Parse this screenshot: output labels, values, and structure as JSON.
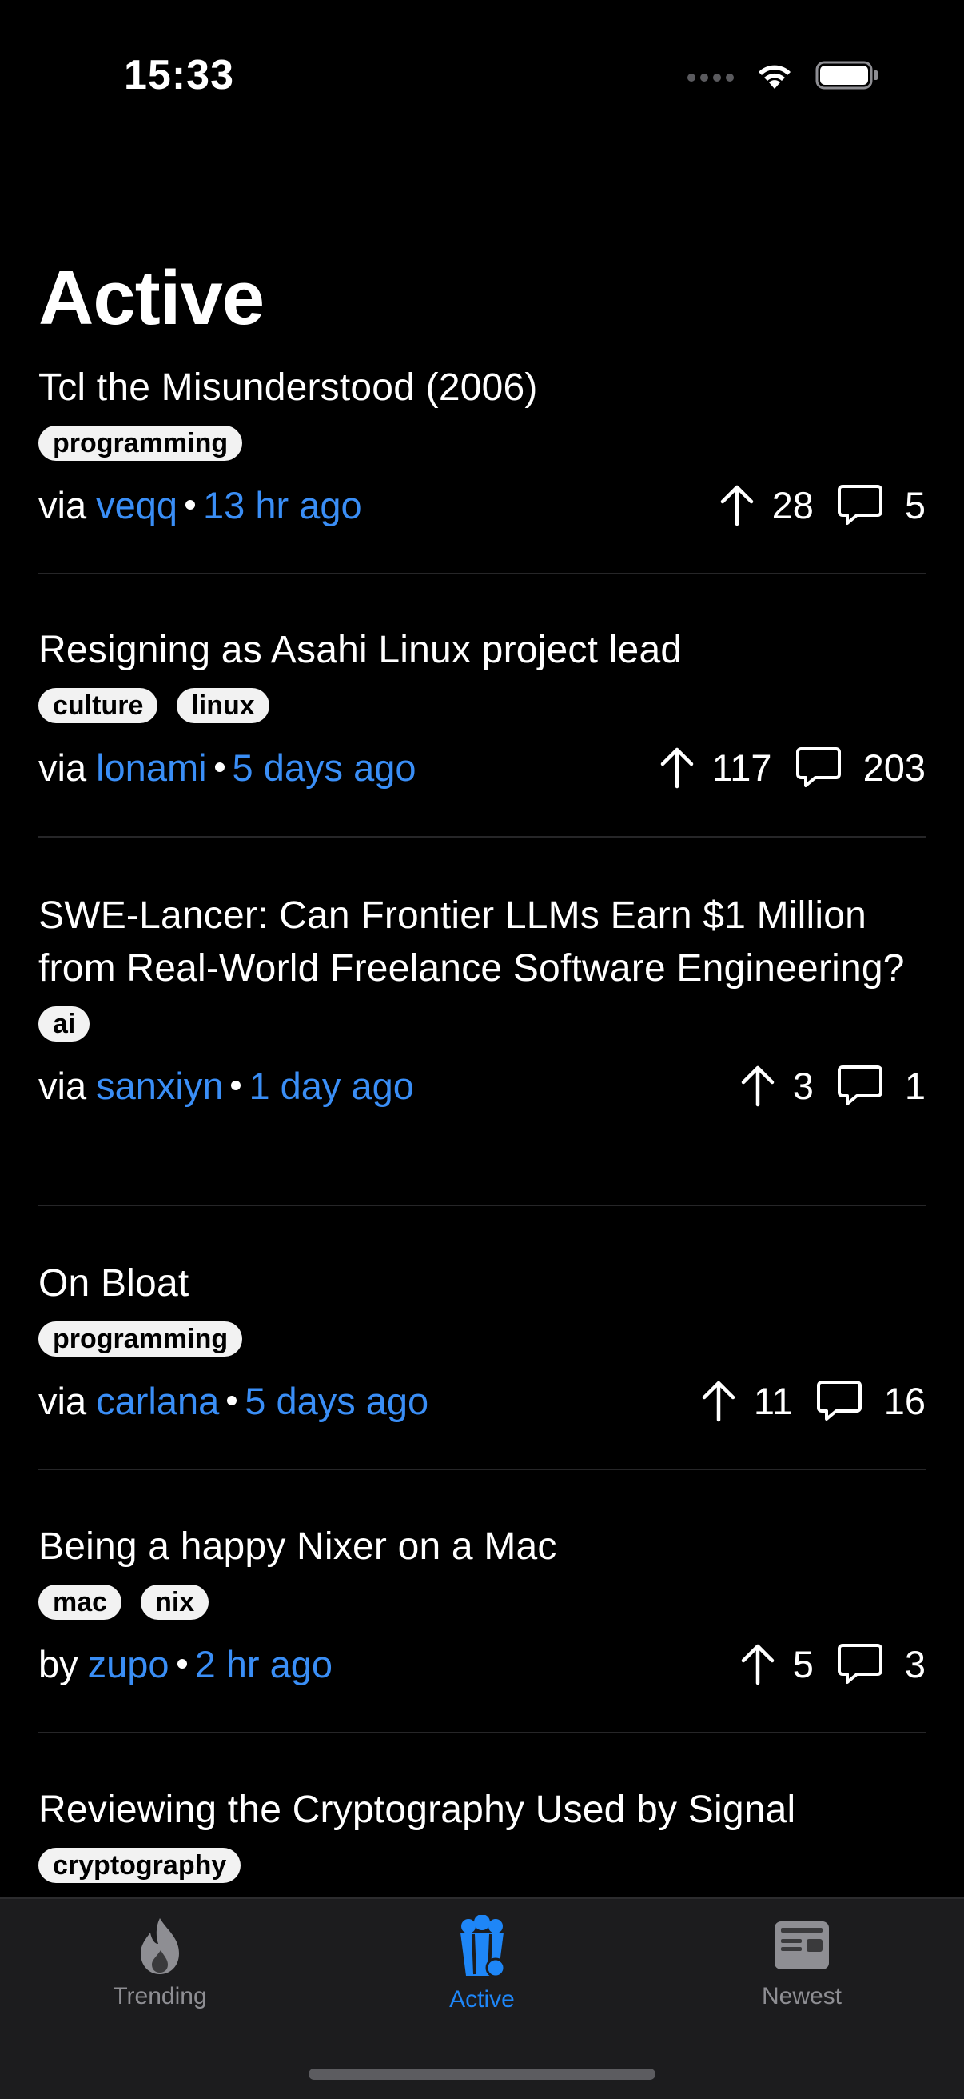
{
  "status_bar": {
    "time": "15:33"
  },
  "header": {
    "title": "Active"
  },
  "colors": {
    "background": "#000000",
    "link": "#3a8ef6",
    "tab_active": "#1e86f7",
    "tab_inactive": "#8e8e93",
    "tag_bg": "#f2f2f2"
  },
  "stories": [
    {
      "title": "Tcl the Misunderstood (2006)",
      "tags": [
        "programming"
      ],
      "prefix": "via",
      "user": "veqq",
      "time": "13 hr ago",
      "score": "28",
      "comments": "5"
    },
    {
      "title": "Resigning as Asahi Linux project lead",
      "tags": [
        "culture",
        "linux"
      ],
      "prefix": "via",
      "user": "lonami",
      "time": "5 days ago",
      "score": "117",
      "comments": "203"
    },
    {
      "title": "SWE-Lancer: Can Frontier LLMs Earn $1 Million from Real-World Freelance Software Engineering?",
      "tags": [
        "ai"
      ],
      "prefix": "via",
      "user": "sanxiyn",
      "time": "1 day ago",
      "score": "3",
      "comments": "1"
    },
    {
      "title": "On Bloat",
      "tags": [
        "programming"
      ],
      "prefix": "via",
      "user": "carlana",
      "time": "5 days ago",
      "score": "11",
      "comments": "16"
    },
    {
      "title": "Being a happy Nixer on a Mac",
      "tags": [
        "mac",
        "nix"
      ],
      "prefix": "by",
      "user": "zupo",
      "time": "2 hr ago",
      "score": "5",
      "comments": "3"
    },
    {
      "title": "Reviewing the Cryptography Used by Signal",
      "tags": [
        "cryptography"
      ],
      "prefix": "",
      "user": "",
      "time": "",
      "score": "",
      "comments": ""
    }
  ],
  "tab_bar": {
    "tabs": [
      {
        "label": "Trending",
        "icon": "flame-icon",
        "active": false
      },
      {
        "label": "Active",
        "icon": "popcorn-icon",
        "active": true
      },
      {
        "label": "Newest",
        "icon": "newspaper-icon",
        "active": false
      }
    ]
  }
}
